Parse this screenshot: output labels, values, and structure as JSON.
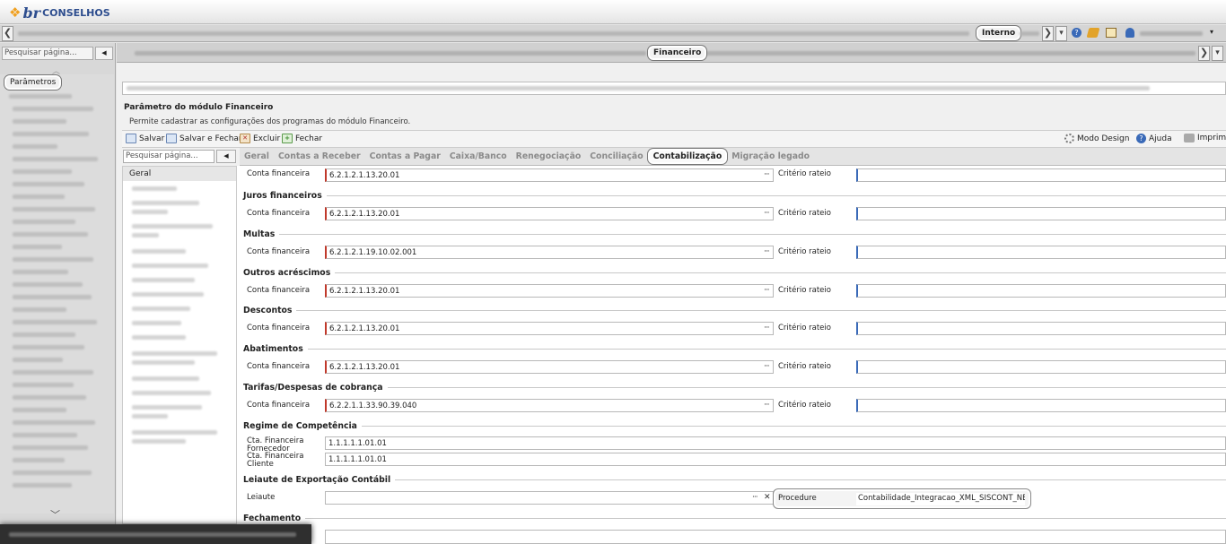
{
  "app": {
    "logo_mark": "❖",
    "brand_br": "br",
    "brand_name": "CONSELHOS"
  },
  "menubar": {
    "highlight": "Interno",
    "prev": "❮",
    "next": "❯",
    "drop": "▾"
  },
  "tabbar": {
    "highlight": "Financeiro",
    "prev": "❮",
    "next": "❯",
    "drop": "▾"
  },
  "left": {
    "search_placeholder": "Pesquisar página...",
    "search_btn": "◀",
    "selected": "Parâmetros",
    "collapse": "︿",
    "expand": "﹀"
  },
  "page": {
    "title": "Parâmetro do módulo Financeiro",
    "description": "Permite cadastrar as configurações dos programas do módulo Financeiro."
  },
  "toolbar": {
    "save": "Salvar",
    "save_close": "Salvar e Fechar",
    "delete": "Excluir",
    "close": "Fechar",
    "design_mode": "Modo Design",
    "help": "Ajuda",
    "print": "Imprimi"
  },
  "subnav": {
    "search_placeholder": "Pesquisar página...",
    "search_btn": "◀",
    "selected": "Geral"
  },
  "tabs": [
    "Geral",
    "Contas a Receber",
    "Contas a Pagar",
    "Caixa/Banco",
    "Renegociação",
    "Conciliação",
    "Contabilização",
    "Migração legado"
  ],
  "form": {
    "lbl_conta": "Conta financeira",
    "lbl_criterio": "Critério rateio",
    "ellipsis": "···",
    "row0_value": "6.2.1.2.1.13.20.01",
    "sections": [
      {
        "title": "Juros financeiros",
        "value": "6.2.1.2.1.13.20.01"
      },
      {
        "title": "Multas",
        "value": "6.2.1.2.1.19.10.02.001"
      },
      {
        "title": "Outros acréscimos",
        "value": "6.2.1.2.1.13.20.01"
      },
      {
        "title": "Descontos",
        "value": "6.2.1.2.1.13.20.01"
      },
      {
        "title": "Abatimentos",
        "value": "6.2.1.2.1.13.20.01"
      },
      {
        "title": "Tarifas/Despesas de cobrança",
        "value": "6.2.2.1.1.33.90.39.040"
      }
    ],
    "regime": {
      "title": "Regime de Competência",
      "fornecedor_lbl1": "Cta. Financeira",
      "fornecedor_lbl2": "Fornecedor",
      "fornecedor_val": "1.1.1.1.1.01.01",
      "cliente_lbl1": "Cta. Financeira",
      "cliente_lbl2": "Cliente",
      "cliente_val": "1.1.1.1.1.01.01"
    },
    "leiaute": {
      "title": "Leiaute de Exportação Contábil",
      "lbl": "Leiaute",
      "ellipsis": "···",
      "clear": "✕",
      "proc_lbl": "Procedure",
      "proc_val": "Contabilidade_Integracao_XML_SISCONT_NET"
    },
    "fechamento": {
      "title": "Fechamento"
    }
  },
  "colors": {
    "brand": "#2d4d8e",
    "accent": "#f0a020",
    "required": "#c0392b"
  }
}
